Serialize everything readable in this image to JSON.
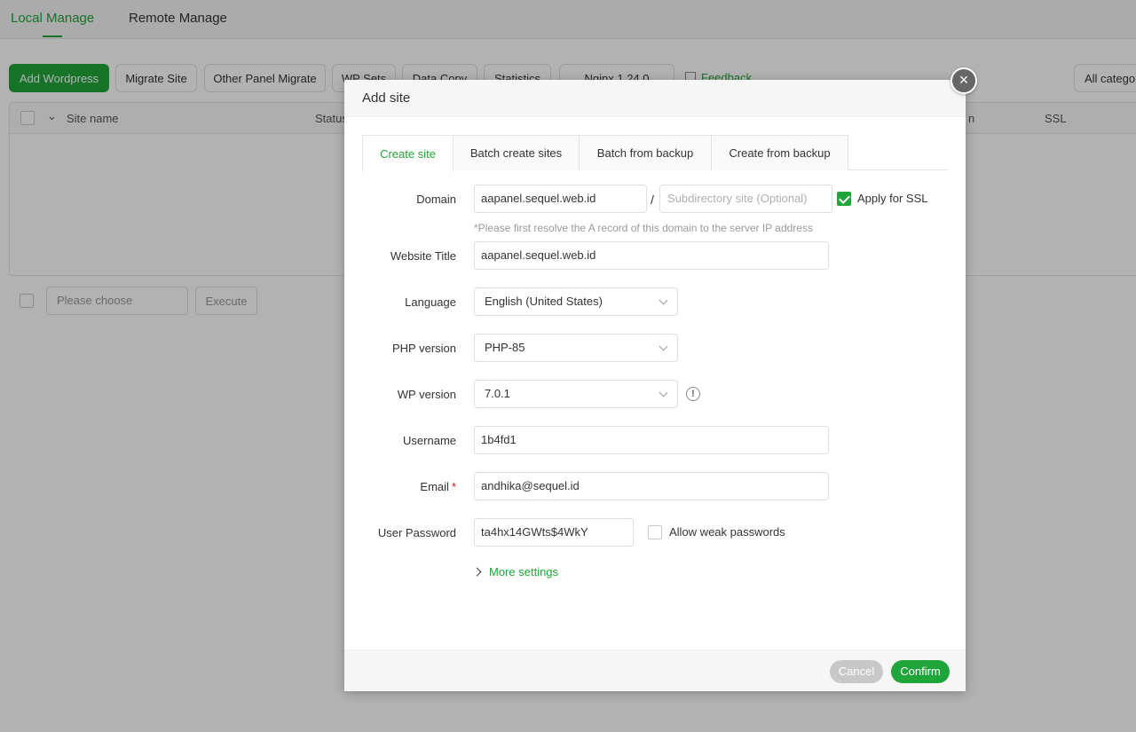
{
  "nav": {
    "tabs": [
      "Local Manage",
      "Remote Manage"
    ]
  },
  "toolbar": {
    "buttons": [
      "Add Wordpress",
      "Migrate Site",
      "Other Panel Migrate",
      "WP Sets",
      "Data Copy",
      "Statistics",
      "Nginx 1.24.0"
    ],
    "feedback": "Feedback",
    "category": "All catego"
  },
  "table": {
    "headers": [
      "Site name",
      "Status",
      "n",
      "SSL"
    ]
  },
  "batch": {
    "placeholder": "Please choose",
    "execute": "Execute"
  },
  "modal": {
    "title": "Add site",
    "close_icon": "×",
    "tabs": [
      "Create site",
      "Batch create sites",
      "Batch from backup",
      "Create from backup"
    ],
    "domain": {
      "label": "Domain",
      "value": "aapanel.sequel.web.id",
      "separator": "/",
      "subdir_placeholder": "Subdirectory site (Optional)",
      "ssl_label": "Apply for SSL",
      "ssl_checked": true,
      "hint": "*Please first resolve the A record of this domain to the server IP address"
    },
    "website_title": {
      "label": "Website Title",
      "value": "aapanel.sequel.web.id"
    },
    "language": {
      "label": "Language",
      "value": "English (United States)"
    },
    "php_version": {
      "label": "PHP version",
      "value": "PHP-85"
    },
    "wp_version": {
      "label": "WP version",
      "value": "7.0.1",
      "info_icon": "!"
    },
    "username": {
      "label": "Username",
      "value": "1b4fd1"
    },
    "email": {
      "label": "Email",
      "required_mark": "*",
      "value": "andhika@sequel.id"
    },
    "password": {
      "label": "User Password",
      "value": "ta4hx14GWts$4WkY",
      "weak_label": "Allow weak passwords",
      "weak_checked": false
    },
    "more_settings": "More settings",
    "footer": {
      "cancel": "Cancel",
      "confirm": "Confirm"
    }
  },
  "colors": {
    "accent": "#20a53a",
    "required": "#ef0808"
  }
}
